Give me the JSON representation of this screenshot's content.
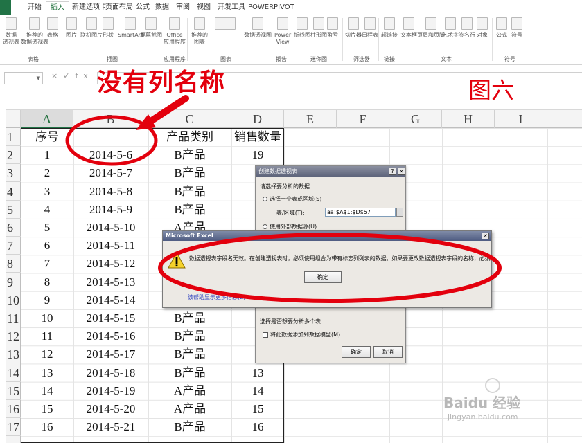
{
  "ribbon_tabs": [
    {
      "label": "开始"
    },
    {
      "label": "插入"
    },
    {
      "label": "新建选项卡"
    },
    {
      "label": "页面布局"
    },
    {
      "label": "公式"
    },
    {
      "label": "数据"
    },
    {
      "label": "审阅"
    },
    {
      "label": "视图"
    },
    {
      "label": "开发工具"
    },
    {
      "label": "POWERPIVOT"
    }
  ],
  "ribbon": {
    "buttons": [
      {
        "label": "数据\n透视表"
      },
      {
        "label": "推荐的\n数据透视表"
      },
      {
        "label": "表格"
      },
      {
        "label": "图片"
      },
      {
        "label": "联机图片"
      },
      {
        "label": "形状"
      },
      {
        "label": "SmartArt"
      },
      {
        "label": "屏幕截图"
      },
      {
        "label": "Office\n应用程序"
      },
      {
        "label": "推荐的\n图表"
      },
      {
        "label": "数据透视图"
      },
      {
        "label": "Power\nView"
      },
      {
        "label": "折线图"
      },
      {
        "label": "柱形图"
      },
      {
        "label": "盈亏"
      },
      {
        "label": "切片器"
      },
      {
        "label": "日程表"
      },
      {
        "label": "超链接"
      },
      {
        "label": "文本框"
      },
      {
        "label": "页眉和页脚"
      },
      {
        "label": "艺术字"
      },
      {
        "label": "签名行"
      },
      {
        "label": "对象"
      },
      {
        "label": "公式"
      },
      {
        "label": "符号"
      }
    ],
    "groups": [
      {
        "label": "表格"
      },
      {
        "label": "插图"
      },
      {
        "label": "应用程序"
      },
      {
        "label": "图表"
      },
      {
        "label": "报告"
      },
      {
        "label": "迷你图"
      },
      {
        "label": "筛选器"
      },
      {
        "label": "链接"
      },
      {
        "label": "文本"
      },
      {
        "label": "符号"
      }
    ]
  },
  "formula_bar": {
    "fx": "fx",
    "cancel": "×",
    "enter": "✓"
  },
  "annotations": {
    "no_col_name": "没有列名称",
    "figure": "图六"
  },
  "columns": [
    "A",
    "B",
    "C",
    "D",
    "E",
    "F",
    "G",
    "H",
    "I"
  ],
  "rows": [
    "1",
    "2",
    "3",
    "4",
    "5",
    "6",
    "7",
    "8",
    "9",
    "10",
    "11",
    "12",
    "13",
    "14",
    "15",
    "16",
    "17"
  ],
  "table": {
    "headers": [
      "序号",
      "",
      "产品类别",
      "销售数量"
    ],
    "rows": [
      [
        "1",
        "2014-5-6",
        "B产品",
        "19"
      ],
      [
        "2",
        "2014-5-7",
        "B产品",
        "2"
      ],
      [
        "3",
        "2014-5-8",
        "B产品",
        "2"
      ],
      [
        "4",
        "2014-5-9",
        "B产品",
        "2"
      ],
      [
        "5",
        "2014-5-10",
        "A产品",
        ""
      ],
      [
        "6",
        "2014-5-11",
        "",
        ""
      ],
      [
        "7",
        "2014-5-12",
        "",
        ""
      ],
      [
        "8",
        "2014-5-13",
        "",
        ""
      ],
      [
        "9",
        "2014-5-14",
        "",
        ""
      ],
      [
        "10",
        "2014-5-15",
        "B产品",
        "1"
      ],
      [
        "11",
        "2014-5-16",
        "B产品",
        "1"
      ],
      [
        "12",
        "2014-5-17",
        "B产品",
        "1"
      ],
      [
        "13",
        "2014-5-18",
        "B产品",
        "13"
      ],
      [
        "14",
        "2014-5-19",
        "A产品",
        "14"
      ],
      [
        "15",
        "2014-5-20",
        "A产品",
        "15"
      ],
      [
        "16",
        "2014-5-21",
        "B产品",
        "16"
      ]
    ]
  },
  "pivot_dialog": {
    "title": "创建数据透视表",
    "help": "?",
    "close": "×",
    "section1": "请选择要分析的数据",
    "option_select_range": "选择一个表或区域(S)",
    "range_label": "表/区域(T):",
    "range_value": "aa!$A$1:$D$57",
    "option_external": "使用外部数据源(U)",
    "section_multi": "选择是否想要分析多个表",
    "add_to_model": "将此数据添加到数据模型(M)",
    "ok": "确定",
    "cancel": "取消"
  },
  "error_dialog": {
    "title": "Microsoft Excel",
    "close": "×",
    "message": "数据透视表字段名无效。在创建透视表时，必须使用组合为带有标志列列表的数据。如果要更改数据透视表字段的名称，必须键入字段的新名称。",
    "ok": "确定",
    "link": "该帮助显示更多信息(E)"
  },
  "watermark": {
    "brand": "Baidu 经验",
    "url": "jingyan.baidu.com"
  }
}
